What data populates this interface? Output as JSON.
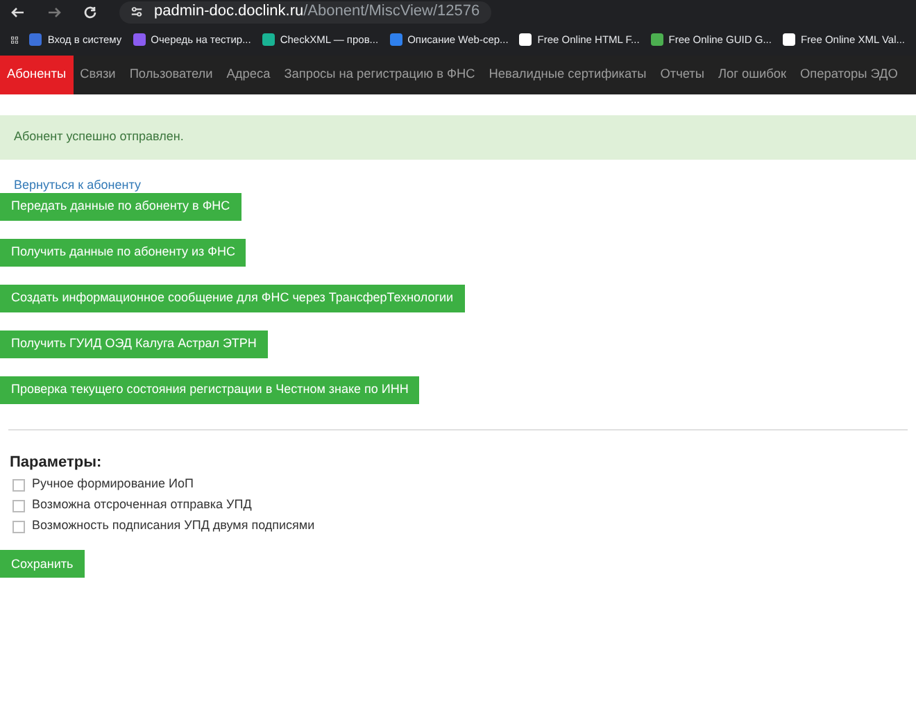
{
  "browser": {
    "url_host": "padmin-doc.doclink.ru",
    "url_path": "/Abonent/MiscView/12576",
    "bookmarks": [
      {
        "label": "Вход в систему",
        "color": "#3b6fd8"
      },
      {
        "label": "Очередь на тестир...",
        "color": "#8a5cf0"
      },
      {
        "label": "CheckXML — пров...",
        "color": "#19b394"
      },
      {
        "label": "Описание Web-сер...",
        "color": "#2f80ed"
      },
      {
        "label": "Free Online HTML F...",
        "color": "#ffffff"
      },
      {
        "label": "Free Online GUID G...",
        "color": "#4caf50"
      },
      {
        "label": "Free Online XML Val...",
        "color": "#ffffff"
      }
    ]
  },
  "nav": [
    {
      "label": "Абоненты",
      "selected": true
    },
    {
      "label": "Связи",
      "selected": false
    },
    {
      "label": "Пользователи",
      "selected": false
    },
    {
      "label": "Адреса",
      "selected": false
    },
    {
      "label": "Запросы на регистрацию в ФНС",
      "selected": false
    },
    {
      "label": "Невалидные сертификаты",
      "selected": false
    },
    {
      "label": "Отчеты",
      "selected": false
    },
    {
      "label": "Лог ошибок",
      "selected": false
    },
    {
      "label": "Операторы ЭДО",
      "selected": false
    }
  ],
  "alert": "Абонент успешно отправлен.",
  "back_link": "Вернуться к абоненту",
  "actions": [
    "Передать данные по абоненту в ФНС",
    "Получить данные по абоненту из ФНС",
    "Создать информационное сообщение для ФНС через ТрансферТехнологии",
    "Получить ГУИД ОЭД Калуга Астрал ЭТРН",
    "Проверка текущего состояния регистрации в Честном знаке по ИНН"
  ],
  "params": {
    "title": "Параметры:",
    "options": [
      {
        "label": "Ручное формирование ИоП",
        "checked": false
      },
      {
        "label": "Возможна отсроченная отправка УПД",
        "checked": false
      },
      {
        "label": "Возможность подписания УПД двумя подписями",
        "checked": false
      }
    ],
    "save": "Сохранить"
  }
}
